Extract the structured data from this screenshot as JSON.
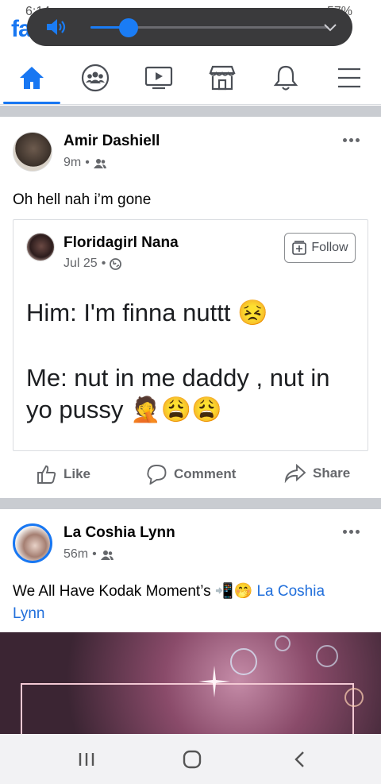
{
  "status_bar": {
    "time": "6:14",
    "battery": "57%"
  },
  "app": {
    "logo_text": "facebook"
  },
  "volume_overlay": {
    "level": 0.16
  },
  "nav": {
    "tabs": [
      {
        "name": "home",
        "active": true
      },
      {
        "name": "groups",
        "active": false
      },
      {
        "name": "watch",
        "active": false
      },
      {
        "name": "marketplace",
        "active": false
      },
      {
        "name": "notifications",
        "active": false
      },
      {
        "name": "menu",
        "active": false
      }
    ]
  },
  "post1": {
    "author": "Amir Dashiell",
    "time": "9m",
    "audience_icon": "friends-icon",
    "text": "Oh hell nah i’m gone",
    "shared": {
      "author": "Floridagirl Nana",
      "date": "Jul 25",
      "audience_icon": "globe-icon",
      "follow_label": "Follow",
      "line1": "Him: I'm finna nuttt",
      "line2": "Me: nut in me daddy , nut in",
      "line3": "yo pussy"
    },
    "actions": {
      "like": "Like",
      "comment": "Comment",
      "share": "Share"
    }
  },
  "post2": {
    "author": "La Coshia Lynn",
    "time": "56m",
    "audience_icon": "friends-icon",
    "text_line1": "We All Have Kodak Moment’s",
    "mention_part1": "La Coshia",
    "mention_part2": "Lynn"
  },
  "colors": {
    "brand": "#1877f2",
    "divider": "#c9ccd1",
    "volume_bg": "#3a3a3c"
  }
}
